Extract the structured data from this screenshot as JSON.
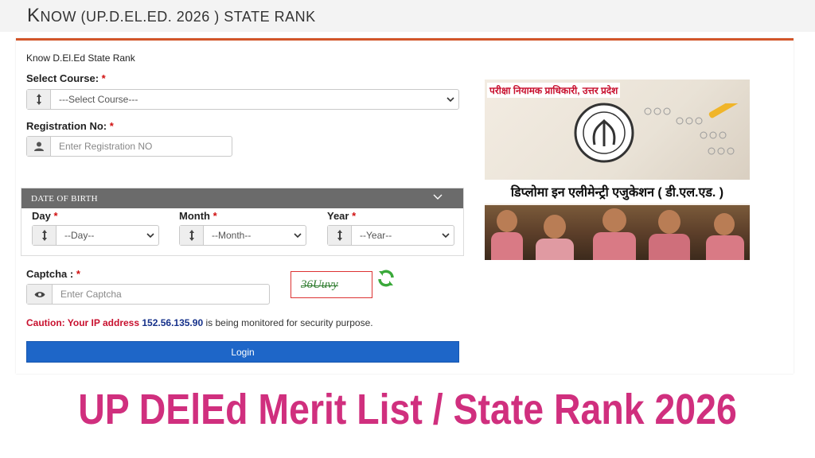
{
  "header": {
    "title_first": "K",
    "title_rest": "NOW (UP.D.EL.ED. 2026 ) STATE RANK"
  },
  "form": {
    "heading": "Know D.El.Ed State Rank",
    "course": {
      "label": "Select Course:",
      "required": "*",
      "value": "---Select Course---"
    },
    "registration": {
      "label": "Registration No:",
      "required": "*",
      "placeholder": "Enter Registration NO"
    },
    "dob": {
      "heading": "DATE OF BIRTH",
      "day": {
        "label": "Day",
        "required": "*",
        "value": "--Day--"
      },
      "month": {
        "label": "Month",
        "required": "*",
        "value": "--Month--"
      },
      "year": {
        "label": "Year",
        "required": "*",
        "value": "--Year--"
      }
    },
    "captcha": {
      "label": "Captcha :",
      "required": "*",
      "placeholder": "Enter Captcha",
      "code": "36Uuvy"
    },
    "caution": {
      "prefix": "Caution: Your IP address",
      "ip": "152.56.135.90",
      "suffix": "is being monitored for security purpose."
    },
    "login_label": "Login"
  },
  "banner": {
    "top_text": "परीक्षा नियामक प्राधिकारी, उत्तर प्रदेश",
    "main_text": "डिप्लोमा इन एलीमेन्ट्री एजुकेशन ( डी.एल.एड. )"
  },
  "headline": "UP DElEd Merit List / State Rank 2026",
  "colors": {
    "accent": "#d2562a",
    "login": "#1e66c8",
    "headline": "#d02f7e",
    "caution": "#c8102e",
    "ip": "#15308a"
  },
  "icons": [
    "sort-icon",
    "user-icon",
    "eye-icon",
    "chevron-down-icon",
    "refresh-icon"
  ]
}
